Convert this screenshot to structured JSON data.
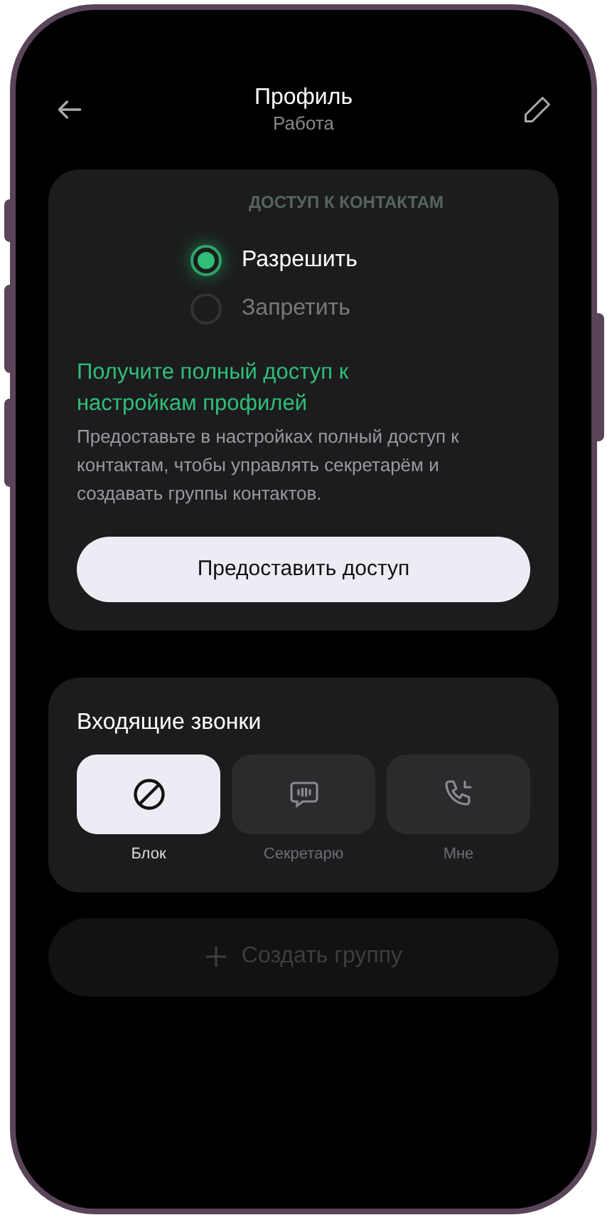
{
  "header": {
    "title": "Профиль",
    "subtitle": "Работа"
  },
  "access_card": {
    "section_title": "ДОСТУП К КОНТАКТАМ",
    "options": [
      {
        "label": "Разрешить",
        "selected": true
      },
      {
        "label": "Запретить",
        "selected": false
      }
    ],
    "promo_title": "Получите полный доступ к настройкам профилей",
    "promo_text": "Предоставьте в настройках полный доступ к контактам, чтобы управлять секретарём и создавать группы контактов.",
    "button": "Предоставить доступ"
  },
  "incoming_calls": {
    "title": "Входящие звонки",
    "options": [
      {
        "kind": "block",
        "label": "Блок",
        "selected": true
      },
      {
        "kind": "secretary",
        "label": "Секретарю",
        "selected": false
      },
      {
        "kind": "me",
        "label": "Мне",
        "selected": false
      }
    ]
  },
  "create_group": {
    "label": "Создать группу",
    "disabled": true
  }
}
